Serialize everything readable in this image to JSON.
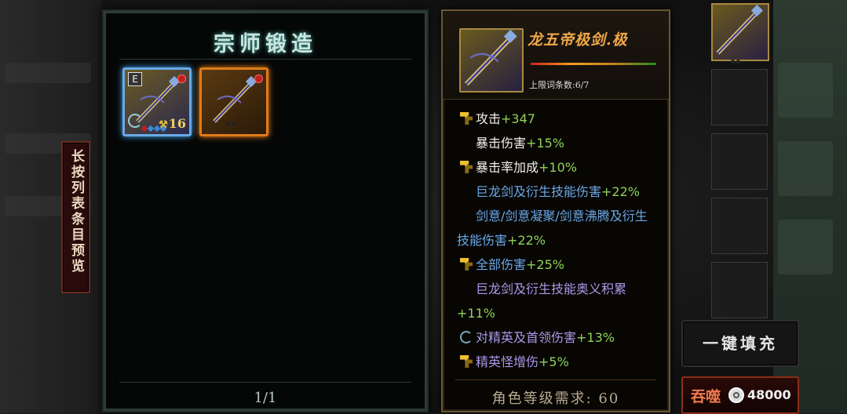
{
  "forge": {
    "title": "宗师锻造",
    "page": "1/1",
    "items": [
      {
        "tag": "E",
        "count": "16"
      },
      {}
    ]
  },
  "side_banner": "长按列表条目预览",
  "detail": {
    "name": "龙五帝极剑.极",
    "limit": "上限词条数:6/7",
    "stats": [
      {
        "icon": "hammer-icon",
        "key": "攻击",
        "value": "+347",
        "style": "white"
      },
      {
        "icon": "",
        "key": "暴击伤害",
        "value": "+15%",
        "style": "white"
      },
      {
        "icon": "hammer-icon",
        "key": "暴击率加成",
        "value": "+10%",
        "style": "white"
      },
      {
        "icon": "",
        "key": "巨龙剑及衍生技能伤害",
        "value": "+22%",
        "style": "blue"
      },
      {
        "icon": "",
        "key": "剑意/剑意凝聚/剑意沸腾及衍生技能伤害",
        "value": "+22%",
        "style": "blue"
      },
      {
        "icon": "hammer-icon",
        "key": "全部伤害",
        "value": "+25%",
        "style": "blue"
      },
      {
        "icon": "",
        "key": "巨龙剑及衍生技能奥义积累",
        "value": "+11%",
        "style": "purple"
      },
      {
        "icon": "cycle-icon",
        "key": "对精英及首领伤害",
        "value": "+13%",
        "style": "purple"
      },
      {
        "icon": "hammer-icon",
        "key": "精英怪增伤",
        "value": "+5%",
        "style": "purple"
      }
    ],
    "requirement": "角色等级需求: 60"
  },
  "actions": {
    "fill_label": "一键填充",
    "devour_label": "吞噬",
    "devour_amount": "48000"
  },
  "colors": {
    "item_name": "#f0a848",
    "value_green": "#8ed25a",
    "blue_affix": "#6aa8e8",
    "purple_affix": "#a89ae8"
  }
}
